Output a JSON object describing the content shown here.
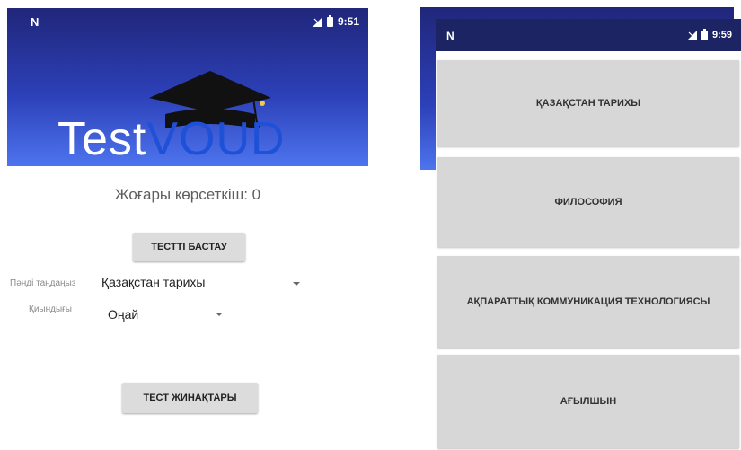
{
  "left_screen": {
    "status": {
      "carrier_icon": "N",
      "time": "9:51"
    },
    "logo": {
      "part1": "Test",
      "part2": "VOUD",
      "color_part2": "#1f50d8"
    },
    "high_score_text": "Жоғары көрсеткіш: 0",
    "start_button": "ТЕСТТІ БАСТАУ",
    "subject_row": {
      "label": "Пәнді таңдаңыз",
      "value": "Қазақстан тарихы"
    },
    "difficulty_row": {
      "label": "Қиындығы",
      "value": "Оңай"
    },
    "collections_button": "ТЕСТ ЖИНАҚТАРЫ"
  },
  "right_screen": {
    "status": {
      "carrier_icon": "N",
      "time": "9:59"
    },
    "subjects": [
      "ҚАЗАҚСТАН ТАРИХЫ",
      "ФИЛОСОФИЯ",
      "АҚПАРАТТЫҚ КОММУНИКАЦИЯ ТЕХНОЛОГИЯСЫ",
      "АҒЫЛШЫН"
    ]
  },
  "colors": {
    "header_dark": "#20267a",
    "header_light": "#4d74ee",
    "button_bg": "#dcdcdc"
  }
}
